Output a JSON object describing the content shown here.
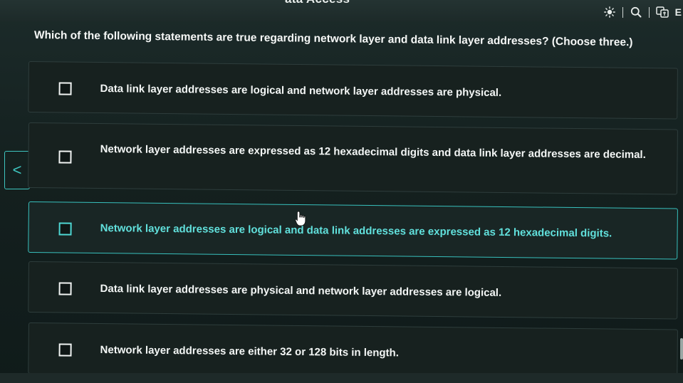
{
  "header": {
    "title_fragment": "ata Access",
    "icons": {
      "brightness": "brightness-icon",
      "search": "search-icon",
      "translate": "translate-icon"
    },
    "trailing_letter": "E"
  },
  "question": {
    "text": "Which of the following statements are true regarding network layer and data link layer addresses? (Choose three.)"
  },
  "options": [
    {
      "label": "Data link layer addresses are logical and network layer addresses are physical.",
      "checked": false,
      "highlighted": false
    },
    {
      "label": "Network layer addresses are expressed as 12 hexadecimal digits and data link layer addresses are decimal.",
      "checked": false,
      "highlighted": false
    },
    {
      "label": "Network layer addresses are logical and data link addresses are expressed as 12 hexadecimal digits.",
      "checked": false,
      "highlighted": true
    },
    {
      "label": "Data link layer addresses are physical and network layer addresses are logical.",
      "checked": false,
      "highlighted": false
    },
    {
      "label": "Network layer addresses are either 32 or 128 bits in length.",
      "checked": false,
      "highlighted": false
    }
  ],
  "navigation": {
    "prev_icon": "chevron-left-icon",
    "prev_glyph": "<"
  },
  "colors": {
    "accent": "#3ec5bf",
    "highlight_text": "#61e0dc",
    "background": "#14201f"
  }
}
